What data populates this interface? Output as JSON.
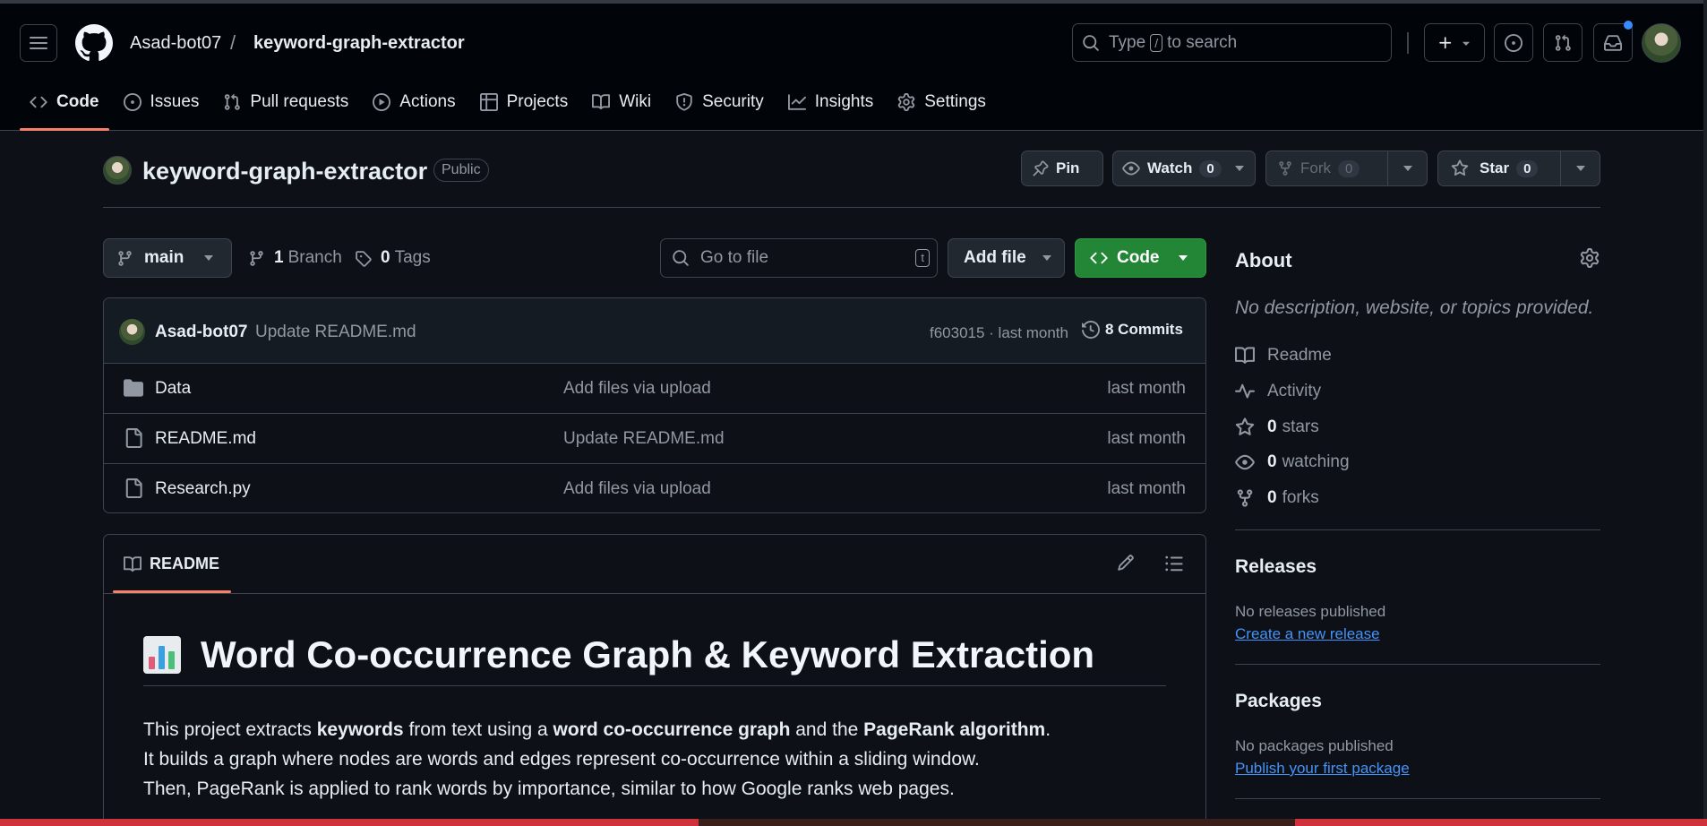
{
  "header": {
    "owner": "Asad-bot07",
    "separator": "/",
    "repo": "keyword-graph-extractor",
    "search_prefix": "Type",
    "search_key": "/",
    "search_suffix": "to search"
  },
  "nav": [
    {
      "label": "Code",
      "icon": "code-icon",
      "active": true
    },
    {
      "label": "Issues",
      "icon": "issue-icon"
    },
    {
      "label": "Pull requests",
      "icon": "pull-request-icon"
    },
    {
      "label": "Actions",
      "icon": "play-icon"
    },
    {
      "label": "Projects",
      "icon": "table-icon"
    },
    {
      "label": "Wiki",
      "icon": "book-icon"
    },
    {
      "label": "Security",
      "icon": "shield-icon"
    },
    {
      "label": "Insights",
      "icon": "graph-icon"
    },
    {
      "label": "Settings",
      "icon": "gear-icon"
    }
  ],
  "repo": {
    "name": "keyword-graph-extractor",
    "visibility": "Public",
    "pin_label": "Pin",
    "watch_label": "Watch",
    "watch_count": "0",
    "fork_label": "Fork",
    "fork_count": "0",
    "star_label": "Star",
    "star_count": "0"
  },
  "branch": {
    "current": "main",
    "branch_count": "1",
    "branch_label": "Branch",
    "tag_count": "0",
    "tag_label": "Tags",
    "goto_placeholder": "Go to file",
    "goto_key": "t",
    "add_file_label": "Add file",
    "code_label": "Code"
  },
  "commit": {
    "author": "Asad-bot07",
    "message": "Update README.md",
    "hash_time": "f603015 · last month",
    "commits_label": "8 Commits"
  },
  "files": [
    {
      "name": "Data",
      "type": "folder",
      "message": "Add files via upload",
      "date": "last month"
    },
    {
      "name": "README.md",
      "type": "file",
      "message": "Update README.md",
      "date": "last month"
    },
    {
      "name": "Research.py",
      "type": "file",
      "message": "Add files via upload",
      "date": "last month"
    }
  ],
  "readme": {
    "tab_label": "README",
    "heading": "Word Co-occurrence Graph & Keyword Extraction",
    "p1_a": "This project extracts ",
    "p1_b": "keywords",
    "p1_c": " from text using a ",
    "p1_d": "word co-occurrence graph",
    "p1_e": " and the ",
    "p1_f": "PageRank algorithm",
    "p1_g": ".",
    "p2": "It builds a graph where nodes are words and edges represent co-occurrence within a sliding window.",
    "p3": "Then, PageRank is applied to rank words by importance, similar to how Google ranks web pages."
  },
  "about": {
    "title": "About",
    "description": "No description, website, or topics provided.",
    "readme_label": "Readme",
    "activity_label": "Activity",
    "stars_count": "0",
    "stars_label": "stars",
    "watching_count": "0",
    "watching_label": "watching",
    "forks_count": "0",
    "forks_label": "forks"
  },
  "releases": {
    "title": "Releases",
    "empty": "No releases published",
    "link": "Create a new release"
  },
  "packages": {
    "title": "Packages",
    "empty": "No packages published",
    "link": "Publish your first package"
  },
  "colors": {
    "background": "#0d1117",
    "header": "#010409",
    "border": "#3d444d",
    "accent_underline": "#f78166",
    "primary_button": "#238636",
    "link": "#4493f8"
  }
}
